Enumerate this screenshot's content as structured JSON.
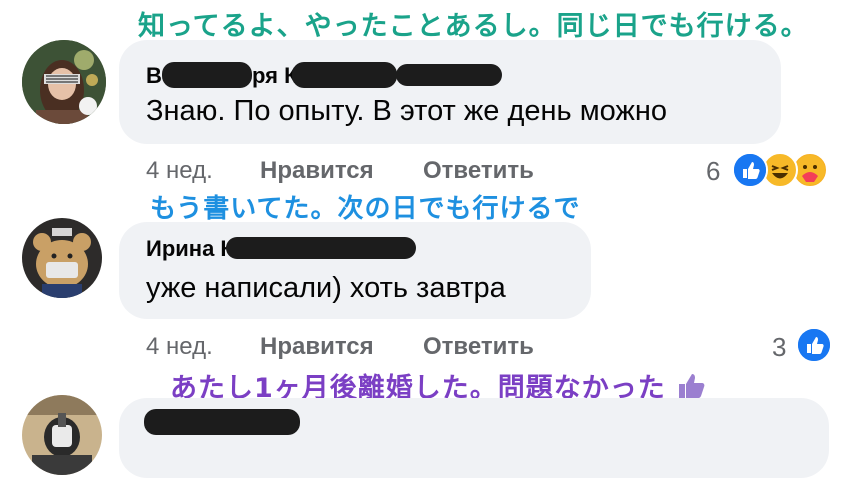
{
  "annotations": {
    "top": "知ってるよ、やったことあるし。同じ日でも行ける。",
    "middle": "もう書いてた。次の日でも行けるで",
    "bottom": "あたし1ヶ月後離婚した。問題なかった",
    "top_color": "#1aa38a",
    "middle_color": "#1e90e0",
    "bottom_color": "#7b3fc4"
  },
  "comments": [
    {
      "author_visible": "В",
      "author_visible_2": "ря К",
      "text": "Знаю. По опыту. В этот же день можно",
      "time": "4 нед.",
      "like_label": "Нравится",
      "reply_label": "Ответить",
      "reaction_count": "6",
      "reactions": [
        "like-icon",
        "laugh-icon",
        "care-icon"
      ]
    },
    {
      "author_visible": "Ирина К",
      "text": "уже написали) хоть завтра",
      "time": "4 нед.",
      "like_label": "Нравится",
      "reply_label": "Ответить",
      "reaction_count": "3",
      "reactions": [
        "like-icon"
      ]
    },
    {
      "author_visible": "",
      "text": "",
      "reactions": []
    }
  ],
  "colors": {
    "bubble": "#f0f2f5",
    "meta_text": "#65676b",
    "like_blue": "#1877f2"
  }
}
